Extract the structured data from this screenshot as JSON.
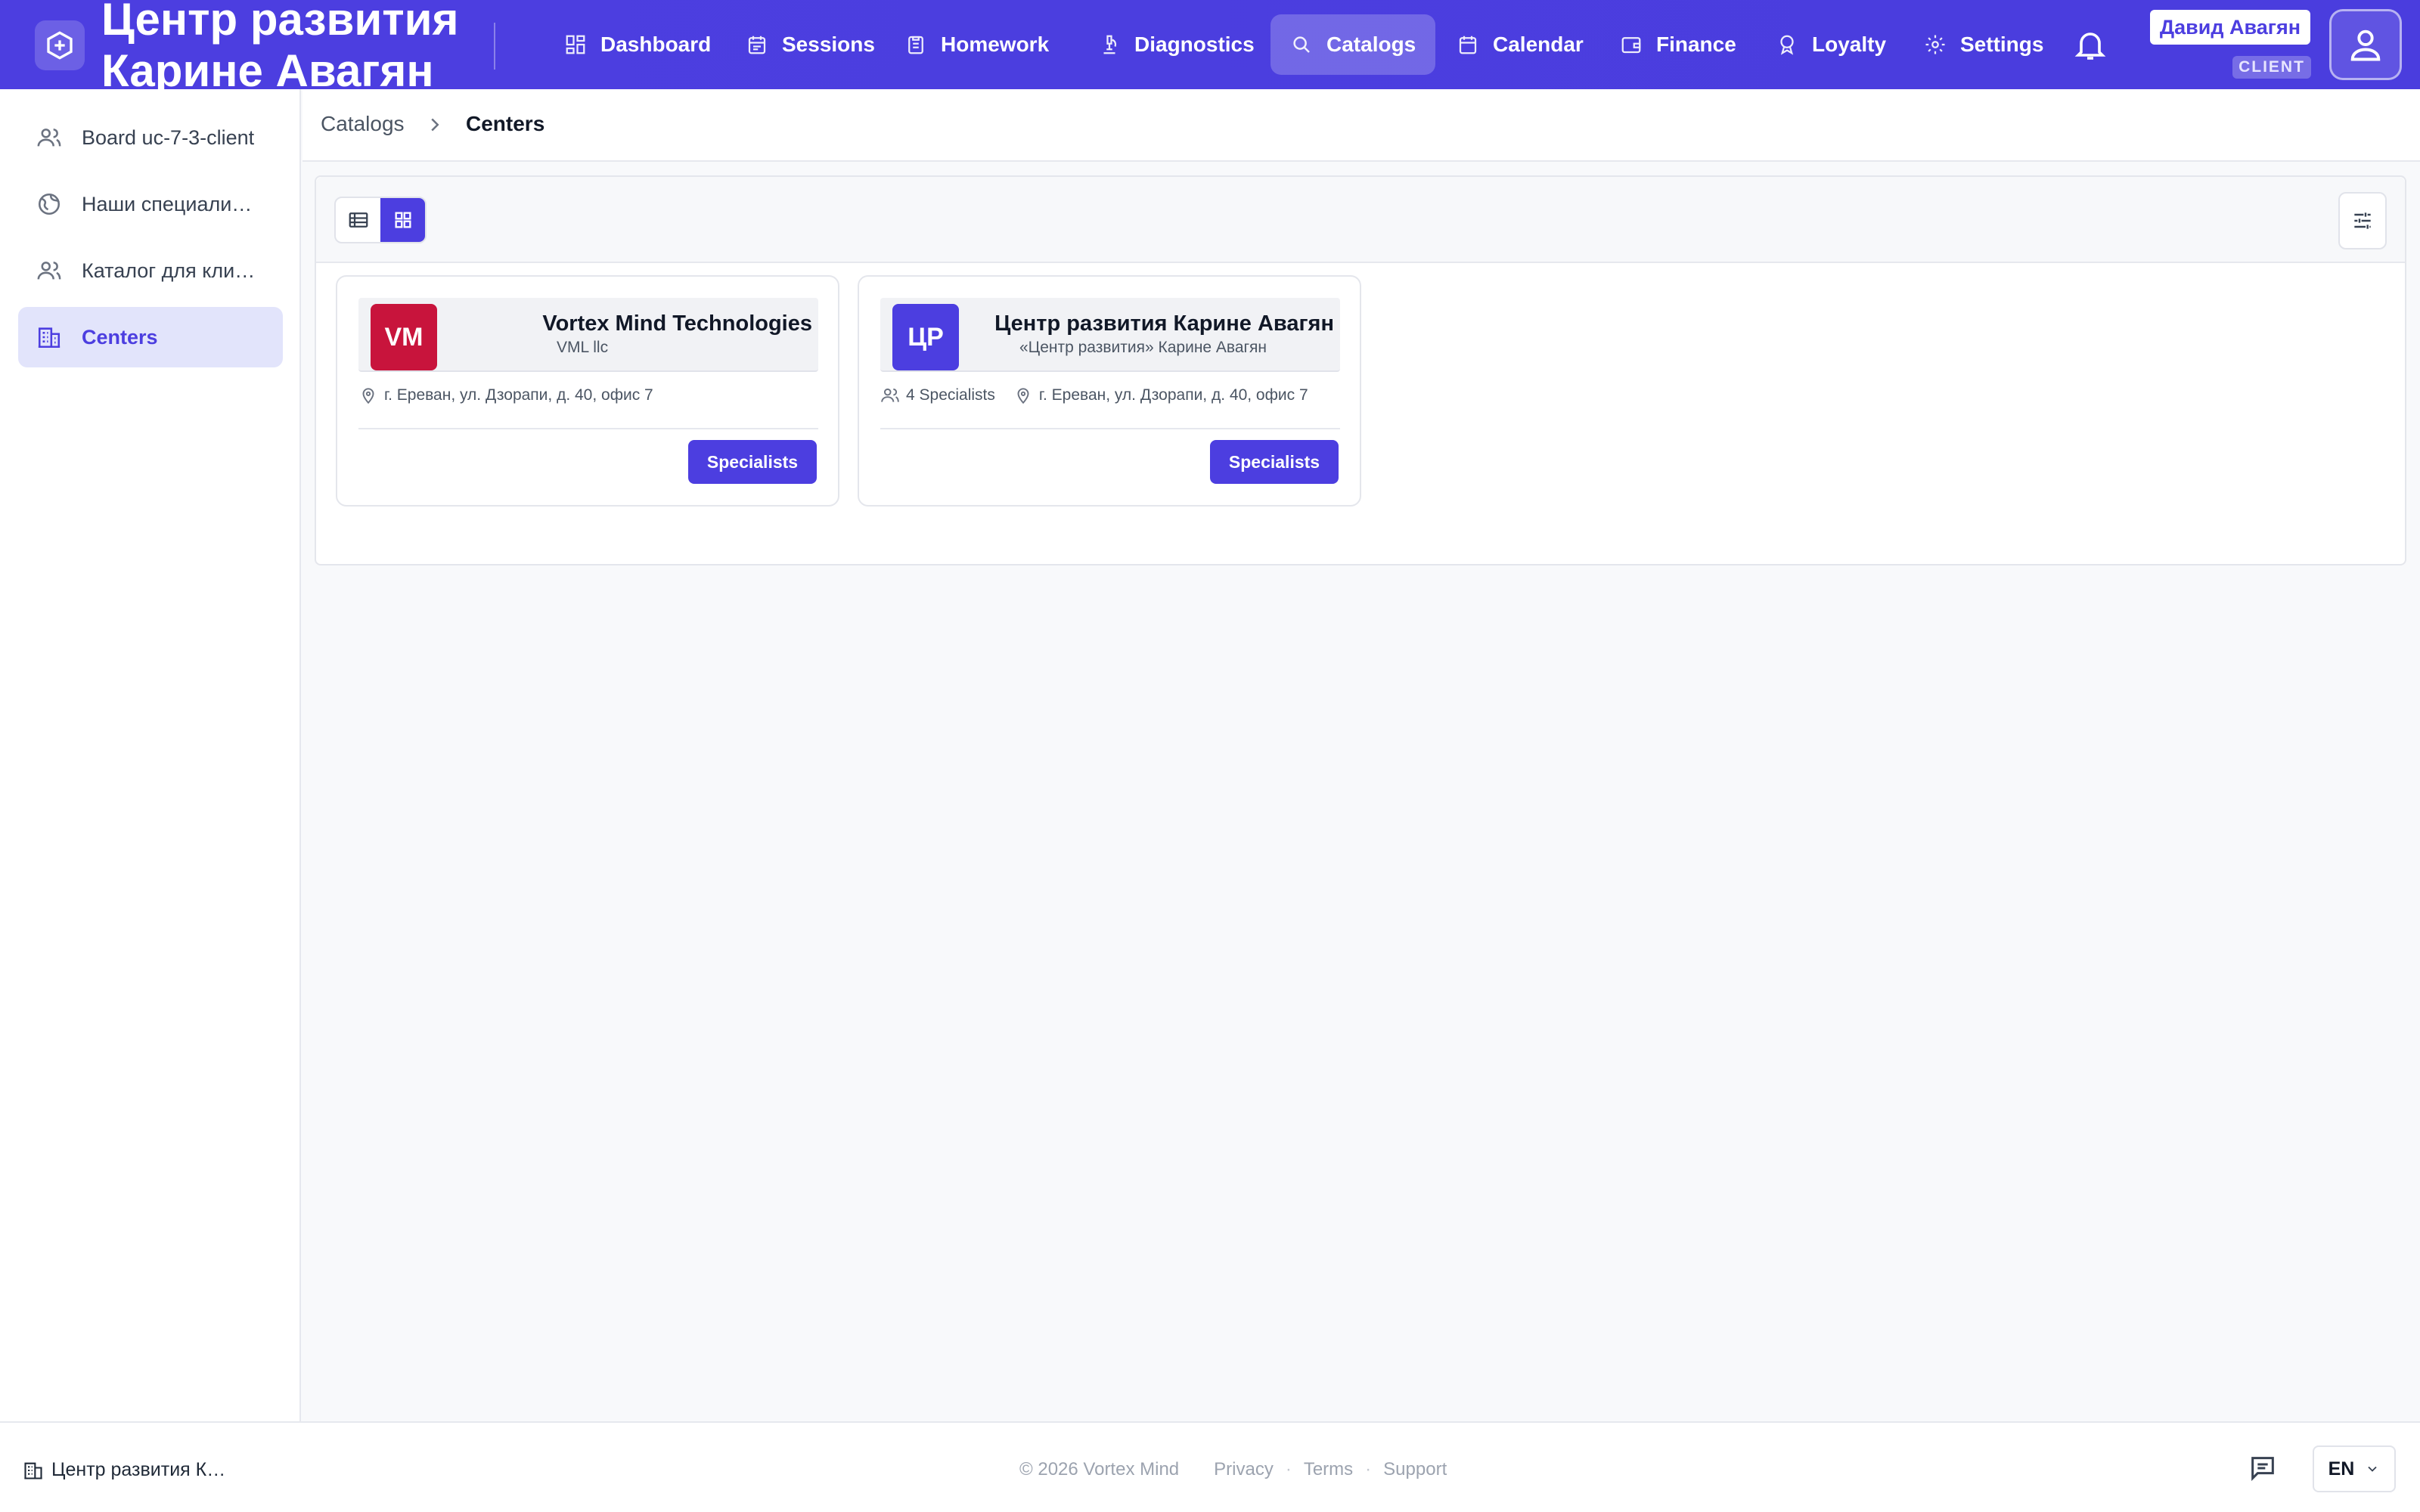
{
  "app": {
    "title_line1": "Центр развития",
    "title_line2": "Карине Авагян",
    "brand_color": "#4c3ee0"
  },
  "nav": [
    {
      "label": "Dashboard",
      "icon": "dashboard-icon"
    },
    {
      "label": "Sessions",
      "icon": "calendar-list-icon"
    },
    {
      "label": "Homework",
      "icon": "clipboard-icon"
    },
    {
      "label": "Diagnostics",
      "icon": "microscope-icon"
    },
    {
      "label": "Catalogs",
      "icon": "search-icon",
      "active": true
    },
    {
      "label": "Calendar",
      "icon": "calendar-icon"
    },
    {
      "label": "Finance",
      "icon": "wallet-icon"
    },
    {
      "label": "Loyalty",
      "icon": "award-icon"
    },
    {
      "label": "Settings",
      "icon": "gear-icon"
    }
  ],
  "user": {
    "name": "Давид Авагян",
    "role": "CLIENT"
  },
  "sidebar": {
    "items": [
      {
        "label": "Board uc-7-3-client",
        "icon": "users-icon"
      },
      {
        "label": "Наши специалисты",
        "icon": "globe-icon"
      },
      {
        "label": "Каталог для клиентов",
        "icon": "users-icon"
      },
      {
        "label": "Centers",
        "icon": "building-icon",
        "active": true
      }
    ]
  },
  "breadcrumb": {
    "parent": "Catalogs",
    "current": "Centers"
  },
  "view": {
    "mode": "grid"
  },
  "cards": [
    {
      "initials": "VM",
      "logo_color": "#c8143c",
      "name": "Vortex Mind Technologies",
      "subtitle": "VML llc",
      "specialists_count": "",
      "address": "г. Ереван, ул. Дзорапи, д. 40, офис 7",
      "button": "Specialists"
    },
    {
      "initials": "ЦР",
      "logo_color": "#4c3ee0",
      "name": "Центр развития Карине Авагян",
      "subtitle": "«Центр развития» Карине Авагян",
      "specialists_count": "4 Specialists",
      "address": "г. Ереван, ул. Дзорапи, д. 40, офис 7",
      "button": "Specialists"
    }
  ],
  "footer": {
    "center_name": "Центр развития Карине Авагян",
    "copyright": "© 2026 Vortex Mind",
    "links": [
      "Privacy",
      "Terms",
      "Support"
    ],
    "language": "EN"
  }
}
